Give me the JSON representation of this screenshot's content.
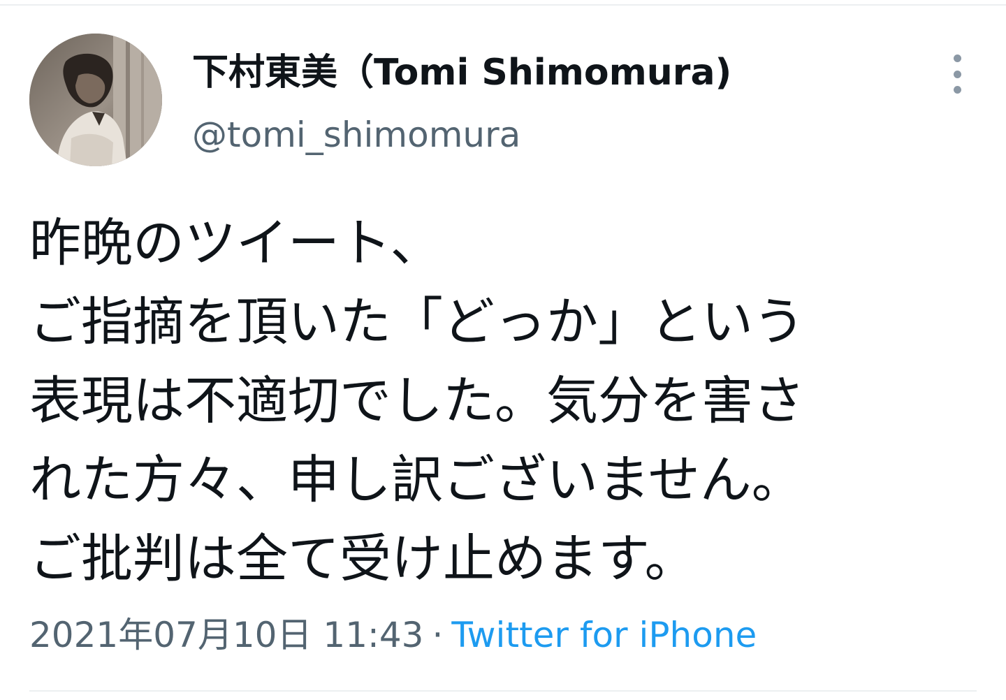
{
  "tweet": {
    "author": {
      "display_name": "下村東美（Tomi Shimomura)",
      "handle": "@tomi_shimomura",
      "avatar_icon": "avatar-photo"
    },
    "more_icon": "more-vertical-icon",
    "text_lines": [
      "昨晩のツイート、",
      "ご指摘を頂いた「どっか」という",
      "表現は不適切でした。気分を害さ",
      "れた方々、申し訳ございません。",
      "ご批判は全て受け止めます。"
    ],
    "timestamp": "2021年07月10日 11:43",
    "separator": "·",
    "source": "Twitter for iPhone"
  },
  "colors": {
    "text": "#0f1419",
    "secondary": "#536471",
    "link": "#1d9bf0",
    "divider": "#eceff1"
  }
}
